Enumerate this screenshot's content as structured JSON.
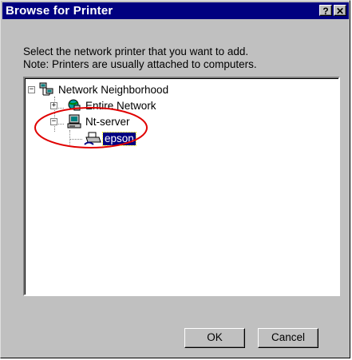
{
  "window": {
    "title": "Browse for Printer",
    "help_label": "?",
    "close_label": "✕"
  },
  "instructions": {
    "line1": "Select the network printer that you want to add.",
    "line2": "Note: Printers are usually attached to computers."
  },
  "tree": {
    "root": {
      "label": "Network Neighborhood",
      "expander": "−",
      "icon": "network-neighborhood-icon"
    },
    "entire_network": {
      "label": "Entire Network",
      "expander": "+",
      "icon": "globe-network-icon"
    },
    "server": {
      "label": "Nt-server",
      "expander": "−",
      "icon": "computer-icon"
    },
    "printer": {
      "label": "epson",
      "icon": "shared-printer-icon",
      "selected": true
    }
  },
  "highlight": {
    "color": "#e00000"
  },
  "buttons": {
    "ok_label": "OK",
    "cancel_label": "Cancel"
  }
}
